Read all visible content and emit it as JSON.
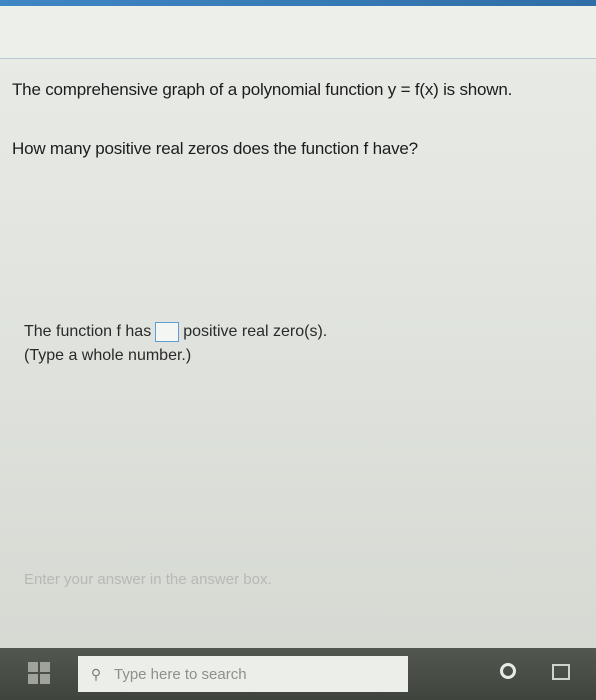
{
  "question": {
    "line1": "The comprehensive graph of a polynomial function y = f(x) is shown.",
    "line2": "How many positive real zeros does the function f have?"
  },
  "answer": {
    "prefix": "The function f has",
    "suffix": "positive real zero(s).",
    "hint": "(Type a whole number.)",
    "input_value": ""
  },
  "footer": {
    "enter_hint": "Enter your answer in the answer box."
  },
  "taskbar": {
    "search_placeholder": "Type here to search",
    "icons": [
      "windows-icon",
      "search-icon",
      "cortana-icon",
      "task-view-icon"
    ]
  },
  "colors": {
    "accent": "#3f86c4",
    "answer_box_border": "#5f9fd6",
    "taskbar": "#444a41"
  }
}
